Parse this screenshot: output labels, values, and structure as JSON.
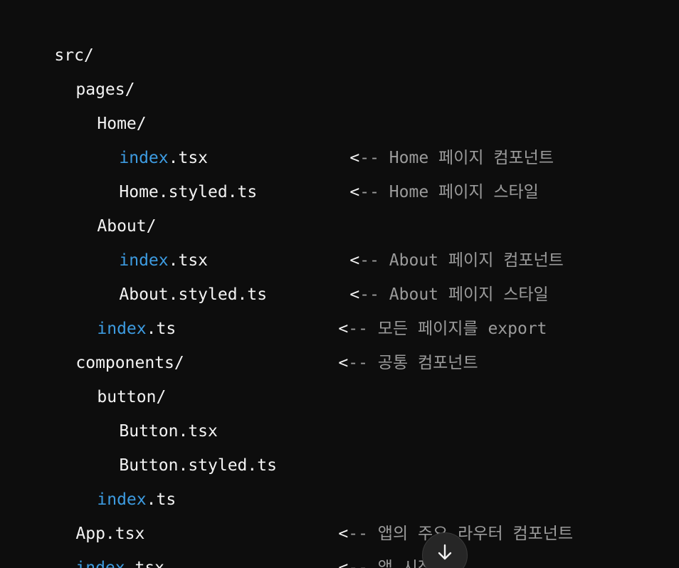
{
  "lines": [
    {
      "indent": 0,
      "name": "src/",
      "arrow_col": null
    },
    {
      "indent": 1,
      "name": "pages/",
      "arrow_col": null
    },
    {
      "indent": 2,
      "name": "Home/",
      "arrow_col": null
    },
    {
      "indent": 3,
      "kw": "index",
      "rest": ".tsx",
      "arrow": "<",
      "dash": "-- ",
      "comment": "Home 페이지 컴포넌트"
    },
    {
      "indent": 3,
      "name": "Home.styled.ts",
      "arrow": "<",
      "dash": "-- ",
      "comment": "Home 페이지 스타일"
    },
    {
      "indent": 2,
      "name": "About/",
      "arrow_col": null
    },
    {
      "indent": 3,
      "kw": "index",
      "rest": ".tsx",
      "arrow": "<",
      "dash": "-- ",
      "comment": "About 페이지 컴포넌트"
    },
    {
      "indent": 3,
      "name": "About.styled.ts",
      "arrow": "<",
      "dash": "-- ",
      "comment": "About 페이지 스타일"
    },
    {
      "indent": 2,
      "kw": "index",
      "rest": ".ts",
      "arrow": "<",
      "dash": "-- ",
      "comment": "모든 페이지를 export"
    },
    {
      "indent": 1,
      "name": "components/",
      "arrow": "<",
      "dash": "-- ",
      "comment": "공통 컴포넌트"
    },
    {
      "indent": 2,
      "name": "button/",
      "arrow_col": null
    },
    {
      "indent": 3,
      "name": "Button.tsx",
      "arrow_col": null
    },
    {
      "indent": 3,
      "name": "Button.styled.ts",
      "arrow_col": null
    },
    {
      "indent": 2,
      "kw": "index",
      "rest": ".ts",
      "arrow_col": null
    },
    {
      "indent": 1,
      "name": "App.tsx",
      "arrow": "<",
      "dash": "-- ",
      "comment": "앱의 주요 라우터 컴포넌트"
    },
    {
      "indent": 1,
      "kw": "index",
      "rest": ".tsx",
      "arrow": "<",
      "dash": "-- ",
      "comment": "앱 시작점"
    }
  ],
  "scroll_button": {
    "icon": "arrow-down-icon",
    "color": "#f3f3f3"
  },
  "colors": {
    "background": "#0d0d0d",
    "keyword": "#3d9be0",
    "comment": "#9b9b9b",
    "text": "#f3f3f3"
  }
}
